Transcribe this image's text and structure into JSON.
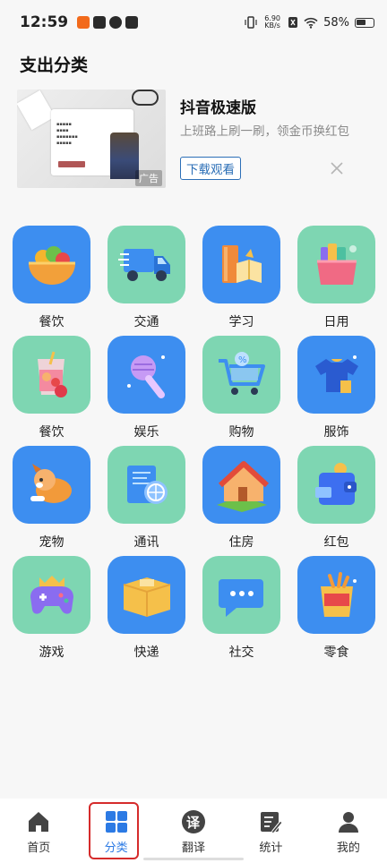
{
  "status": {
    "time": "12:59",
    "speed_top": "6.90",
    "speed_bottom": "KB/s",
    "battery": "58%"
  },
  "page": {
    "title": "支出分类"
  },
  "ad": {
    "title": "抖音极速版",
    "description": "上班路上刷一刷，领金币换红包",
    "button": "下载观看",
    "tag": "广告"
  },
  "categories": [
    {
      "label": "餐饮",
      "bg": "#3d8ef0",
      "icon": "food-bowl-icon"
    },
    {
      "label": "交通",
      "bg": "#7ed6b2",
      "icon": "truck-icon"
    },
    {
      "label": "学习",
      "bg": "#3d8ef0",
      "icon": "books-icon"
    },
    {
      "label": "日用",
      "bg": "#7ed6b2",
      "icon": "gift-bag-icon"
    },
    {
      "label": "餐饮",
      "bg": "#7ed6b2",
      "icon": "drink-icon"
    },
    {
      "label": "娱乐",
      "bg": "#3d8ef0",
      "icon": "microphone-icon"
    },
    {
      "label": "购物",
      "bg": "#7ed6b2",
      "icon": "shopping-cart-icon"
    },
    {
      "label": "服饰",
      "bg": "#3d8ef0",
      "icon": "clothes-icon"
    },
    {
      "label": "宠物",
      "bg": "#3d8ef0",
      "icon": "dog-icon"
    },
    {
      "label": "通讯",
      "bg": "#7ed6b2",
      "icon": "communication-icon"
    },
    {
      "label": "住房",
      "bg": "#3d8ef0",
      "icon": "house-icon"
    },
    {
      "label": "红包",
      "bg": "#7ed6b2",
      "icon": "wallet-icon"
    },
    {
      "label": "游戏",
      "bg": "#7ed6b2",
      "icon": "gamepad-icon"
    },
    {
      "label": "快递",
      "bg": "#3d8ef0",
      "icon": "package-icon"
    },
    {
      "label": "社交",
      "bg": "#7ed6b2",
      "icon": "chat-bubble-icon"
    },
    {
      "label": "零食",
      "bg": "#3d8ef0",
      "icon": "snack-bag-icon"
    }
  ],
  "nav": [
    {
      "label": "首页",
      "icon": "home-icon",
      "active": false
    },
    {
      "label": "分类",
      "icon": "grid-icon",
      "active": true
    },
    {
      "label": "翻译",
      "icon": "translate-icon",
      "active": false
    },
    {
      "label": "统计",
      "icon": "edit-icon",
      "active": false
    },
    {
      "label": "我的",
      "icon": "user-icon",
      "active": false
    }
  ],
  "colors": {
    "accent": "#2c7ae4",
    "highlight": "#d52b2b",
    "tile_blue": "#3d8ef0",
    "tile_green": "#7ed6b2"
  }
}
